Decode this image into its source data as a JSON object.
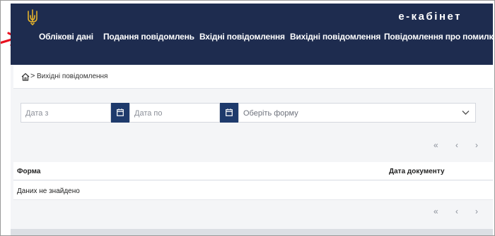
{
  "header": {
    "brand": "е-кабінет",
    "nav": [
      {
        "label": "Облікові дані"
      },
      {
        "label": "Подання повідомлень"
      },
      {
        "label": "Вхідні повідомлення"
      },
      {
        "label": "Вихідні повідомлення"
      },
      {
        "label": "Повідомлення про помилку"
      }
    ],
    "logo_icon": "trident-icon",
    "annotation_icon": "red-arrow-icon",
    "colors": {
      "header_bg": "#1e2c4f",
      "accent": "#1e3a6c",
      "annotation": "#e8101f"
    }
  },
  "breadcrumb": {
    "home_icon": "home-icon",
    "separator": ">",
    "current": "Вихідні повідомлення"
  },
  "filters": {
    "date_from_placeholder": "Дата з",
    "date_to_placeholder": "Дата по",
    "form_select_placeholder": "Оберіть форму",
    "calendar_icon": "calendar-icon",
    "dropdown_icon": "chevron-down-icon"
  },
  "pagination": {
    "first": "«",
    "prev": "‹",
    "next": "›"
  },
  "table": {
    "columns": [
      "Форма",
      "Дата документу"
    ],
    "empty_message": "Даних не знайдено"
  }
}
